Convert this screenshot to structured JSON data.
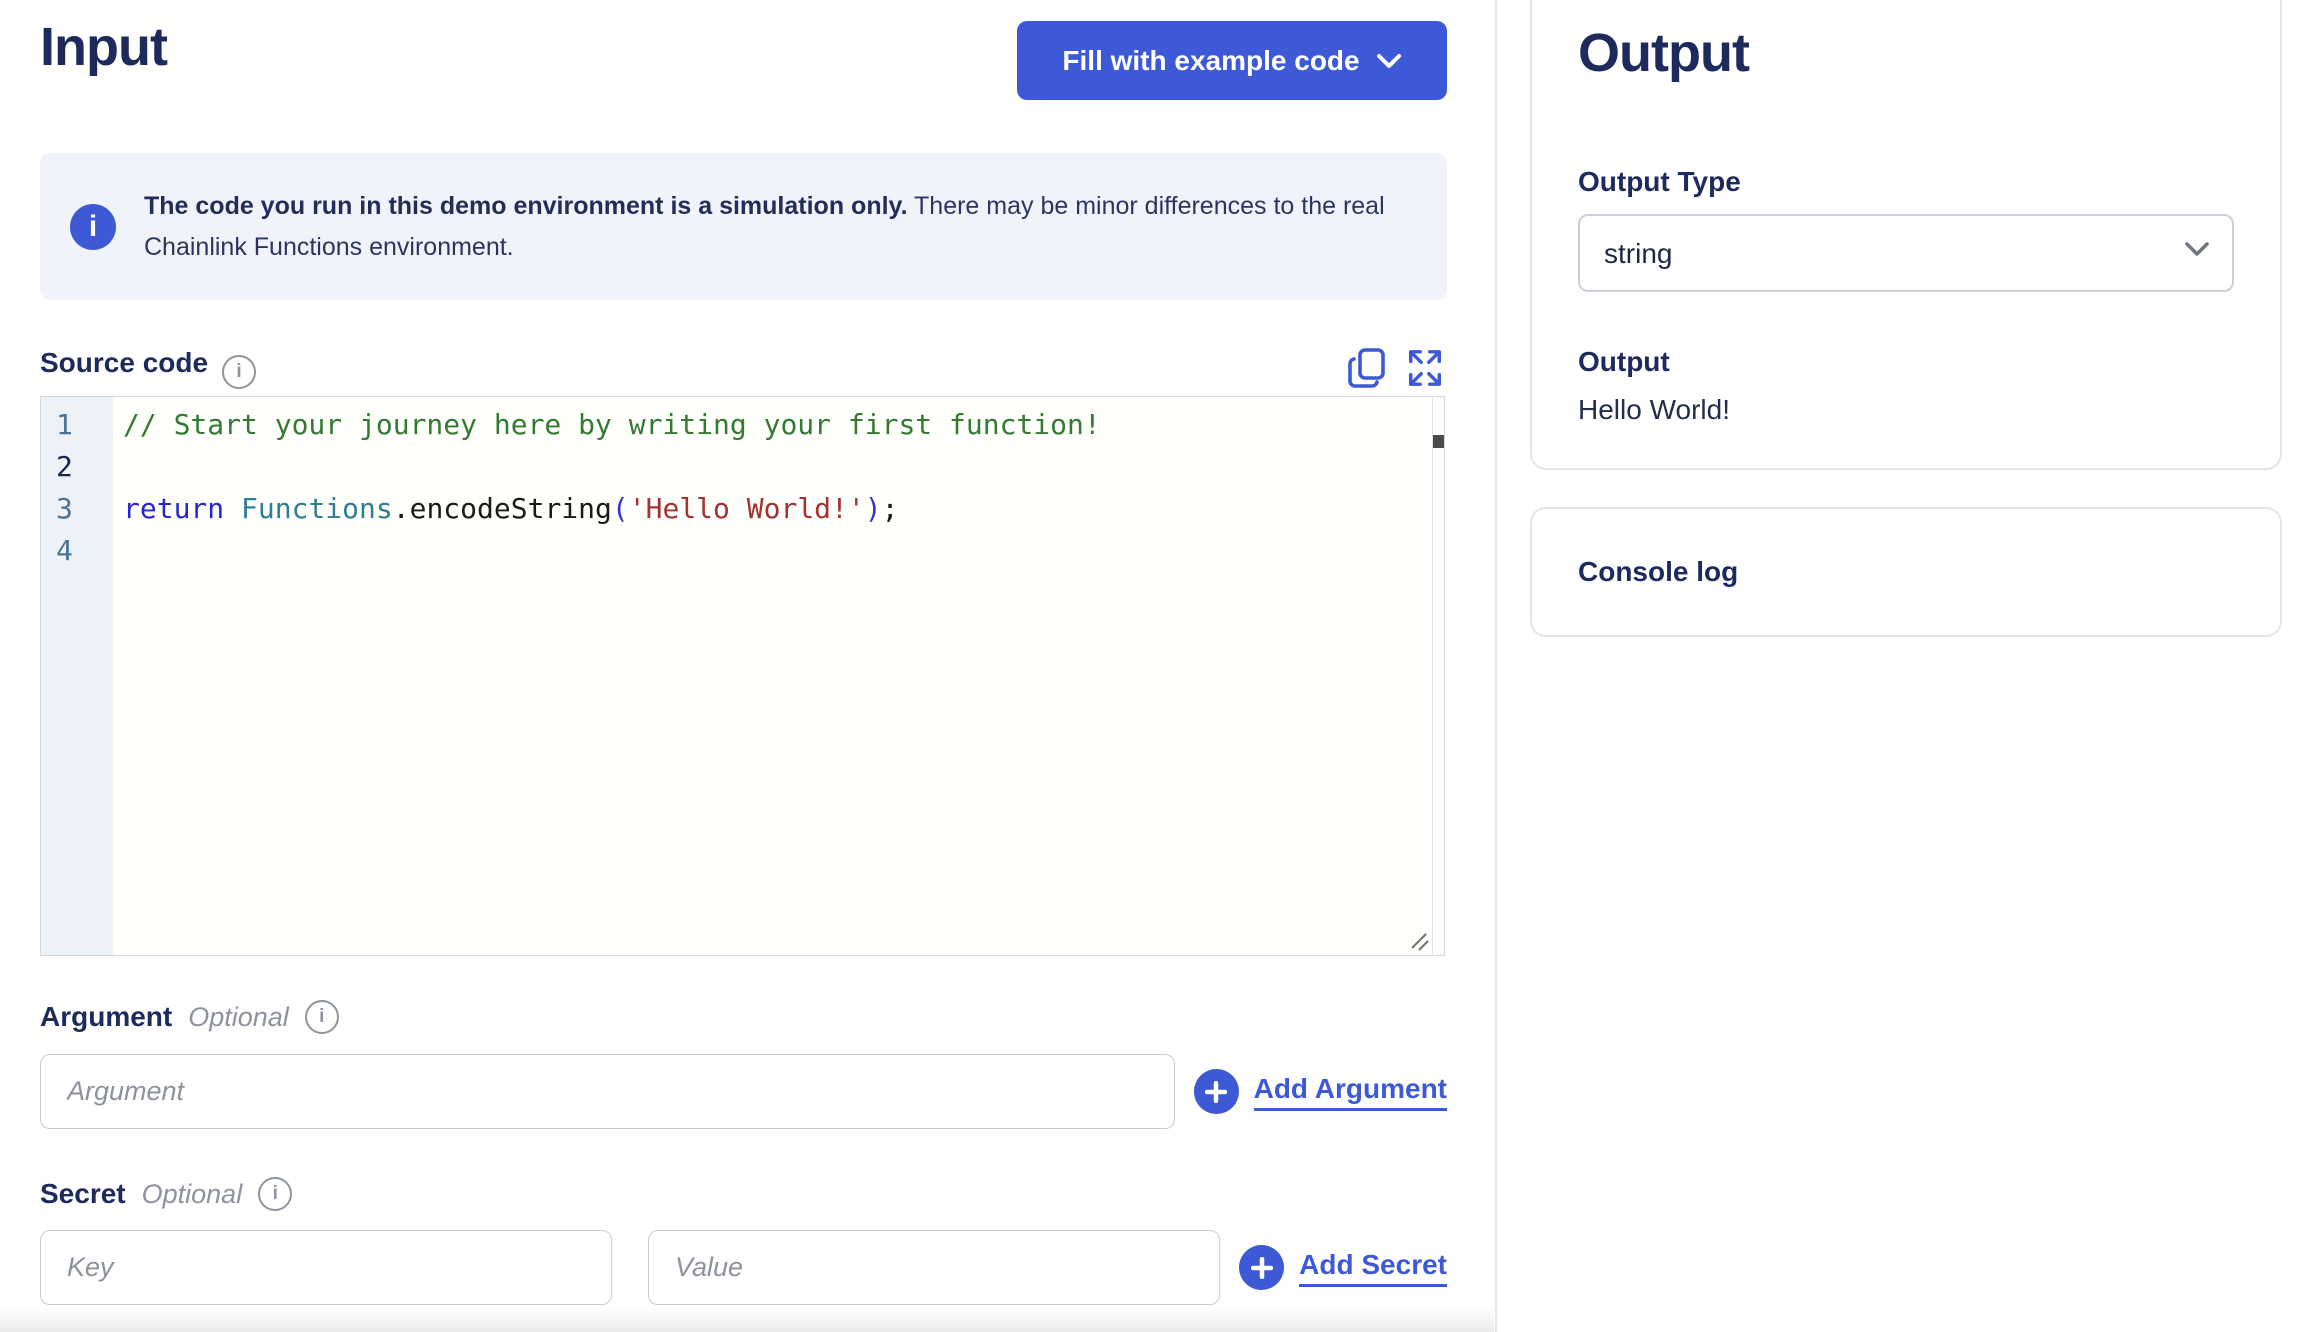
{
  "colors": {
    "accent_blue": "#3D59D6",
    "heading_navy": "#1D2A5C",
    "body_navy": "#2B3560",
    "muted_gray": "#8D929C",
    "banner_bg": "#F1F3FA",
    "gutter_bg": "#EDF1F8",
    "syntax": {
      "comment": "#337A33",
      "keyword": "#2626CD",
      "variable": "#2E7F93",
      "string": "#A23333",
      "bracket": "#3333CF",
      "plain": "#1A1A1A",
      "line_number": "#4A7396",
      "line_number_active": "#16254E"
    }
  },
  "input_panel": {
    "title": "Input",
    "fill_button_label": "Fill with example code",
    "banner_bold": "The code you run in this demo environment is a simulation only.",
    "banner_rest": " There may be minor differences to the real Chainlink Functions environment.",
    "source_code": {
      "label": "Source code",
      "active_line": 2,
      "lines": [
        {
          "num": 1,
          "tokens": [
            {
              "t": "// Start your journey here by writing your first function!",
              "c": "comment"
            }
          ]
        },
        {
          "num": 2,
          "tokens": []
        },
        {
          "num": 3,
          "tokens": [
            {
              "t": "return",
              "c": "keyword"
            },
            {
              "t": " ",
              "c": "plain"
            },
            {
              "t": "Functions",
              "c": "variable"
            },
            {
              "t": ".encodeString",
              "c": "plain"
            },
            {
              "t": "(",
              "c": "bracket"
            },
            {
              "t": "'Hello World!'",
              "c": "string"
            },
            {
              "t": ")",
              "c": "bracket"
            },
            {
              "t": ";",
              "c": "plain"
            }
          ]
        },
        {
          "num": 4,
          "tokens": []
        }
      ]
    },
    "argument": {
      "label": "Argument",
      "optional_label": "Optional",
      "placeholder": "Argument",
      "add_label": "Add Argument"
    },
    "secret": {
      "label": "Secret",
      "optional_label": "Optional",
      "key_placeholder": "Key",
      "value_placeholder": "Value",
      "add_label": "Add Secret"
    }
  },
  "output_panel": {
    "title": "Output",
    "output_type_label": "Output Type",
    "output_type_value": "string",
    "output_label": "Output",
    "output_value": "Hello World!",
    "console_log_label": "Console log"
  },
  "icons": {
    "fill_button": "chevron-down-icon",
    "banner": "info-filled-icon",
    "labels": "info-outline-icon",
    "code_actions": [
      "copy-icon",
      "expand-icon"
    ],
    "add_buttons": "plus-circle-icon",
    "select": "chevron-down-icon"
  }
}
